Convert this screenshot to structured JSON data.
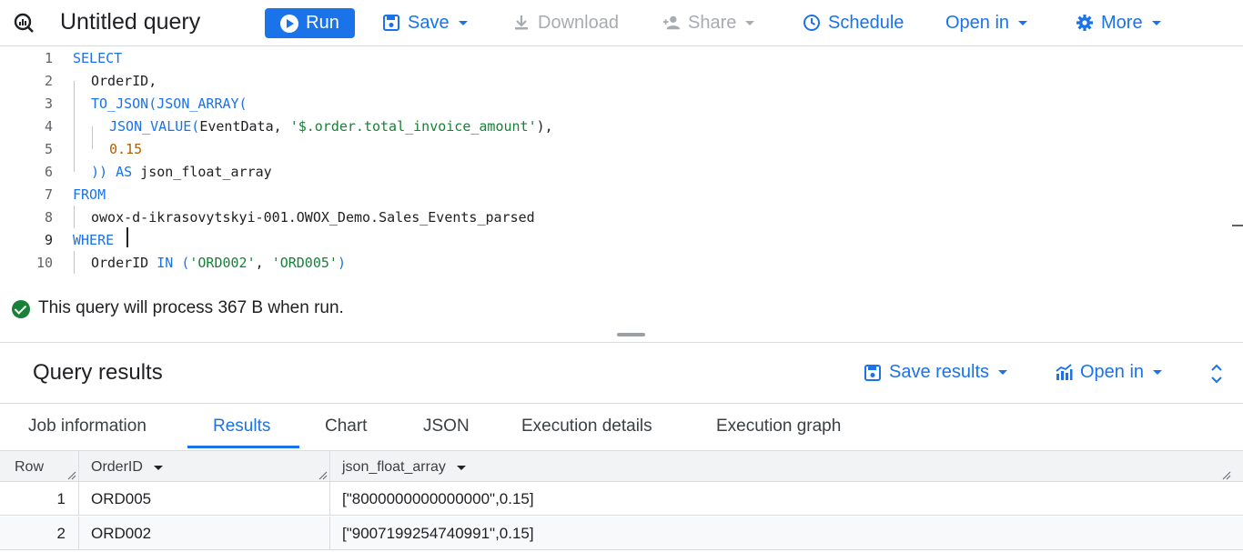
{
  "toolbar": {
    "title": "Untitled query",
    "run_label": "Run",
    "save_label": "Save",
    "download_label": "Download",
    "share_label": "Share",
    "schedule_label": "Schedule",
    "open_in_label": "Open in",
    "more_label": "More"
  },
  "editor": {
    "lines": [
      {
        "n": "1"
      },
      {
        "n": "2"
      },
      {
        "n": "3"
      },
      {
        "n": "4"
      },
      {
        "n": "5"
      },
      {
        "n": "6"
      },
      {
        "n": "7"
      },
      {
        "n": "8"
      },
      {
        "n": "9"
      },
      {
        "n": "10"
      }
    ],
    "tokens": {
      "l1_kw": "SELECT",
      "l2_txt": "OrderID,",
      "l3_fn": "TO_JSON(JSON_ARRAY(",
      "l4_fn": "JSON_VALUE(",
      "l4_txt": "EventData, ",
      "l4_str": "'$.order.total_invoice_amount'",
      "l4_end": "),",
      "l5_num": "0.15",
      "l6_fn": "))",
      "l6_kw": " AS",
      "l6_txt": " json_float_array",
      "l7_kw": "FROM",
      "l8_txt": "owox-d-ikrasovytskyi-001.OWOX_Demo.Sales_Events_parsed",
      "l9_kw": "WHERE",
      "l10_txt": "OrderID ",
      "l10_kw": "IN (",
      "l10_str1": "'ORD002'",
      "l10_sep": ", ",
      "l10_str2": "'ORD005'",
      "l10_end": ")"
    }
  },
  "status": {
    "message": "This query will process 367 B when run."
  },
  "results": {
    "title": "Query results",
    "save_results_label": "Save results",
    "open_in_label": "Open in",
    "tabs": [
      {
        "label": "Job information"
      },
      {
        "label": "Results"
      },
      {
        "label": "Chart"
      },
      {
        "label": "JSON"
      },
      {
        "label": "Execution details"
      },
      {
        "label": "Execution graph"
      }
    ],
    "columns": [
      "Row",
      "OrderID",
      "json_float_array"
    ],
    "rows": [
      {
        "row": "1",
        "order_id": "ORD005",
        "json_float_array": "[\"8000000000000000\",0.15]"
      },
      {
        "row": "2",
        "order_id": "ORD002",
        "json_float_array": "[\"9007199254740991\",0.15]"
      }
    ]
  },
  "colors": {
    "accent": "#1a73e8",
    "success": "#188038",
    "string": "#188038",
    "number": "#b06000"
  }
}
